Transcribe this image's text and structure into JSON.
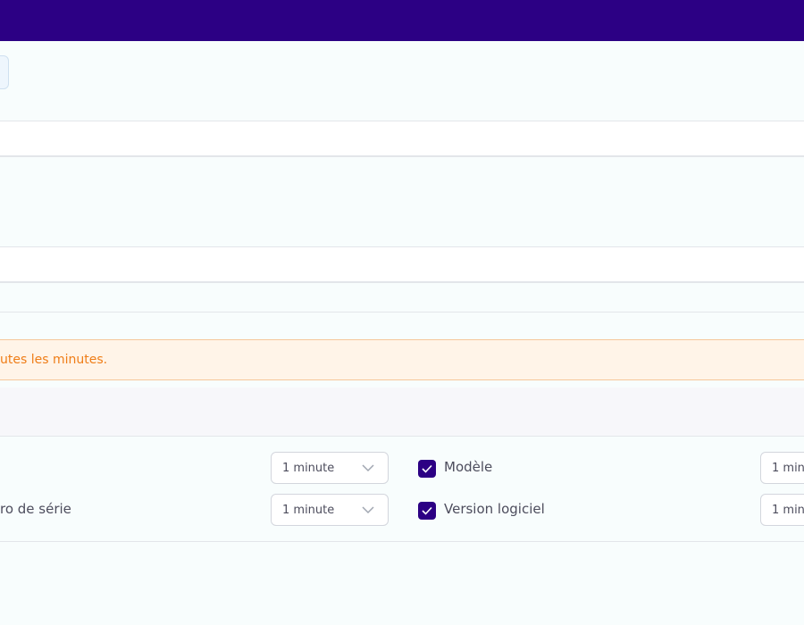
{
  "alert": {
    "message": "utes les minutes."
  },
  "settings": {
    "rows": [
      {
        "label": "",
        "interval": "1 minute",
        "checkbox_label": "Modèle",
        "checked": true,
        "interval_right": "1 min"
      },
      {
        "label": "ro de série",
        "interval": "1 minute",
        "checkbox_label": "Version logiciel",
        "checked": true,
        "interval_right": "1 min"
      }
    ]
  },
  "colors": {
    "header": "#2c0084",
    "checkbox": "#2c0084",
    "alert_text": "#ef7d17",
    "alert_bg": "#fff4e8"
  },
  "icons": {
    "select_arrow": "chevron-down-icon",
    "check": "checkmark-icon"
  }
}
